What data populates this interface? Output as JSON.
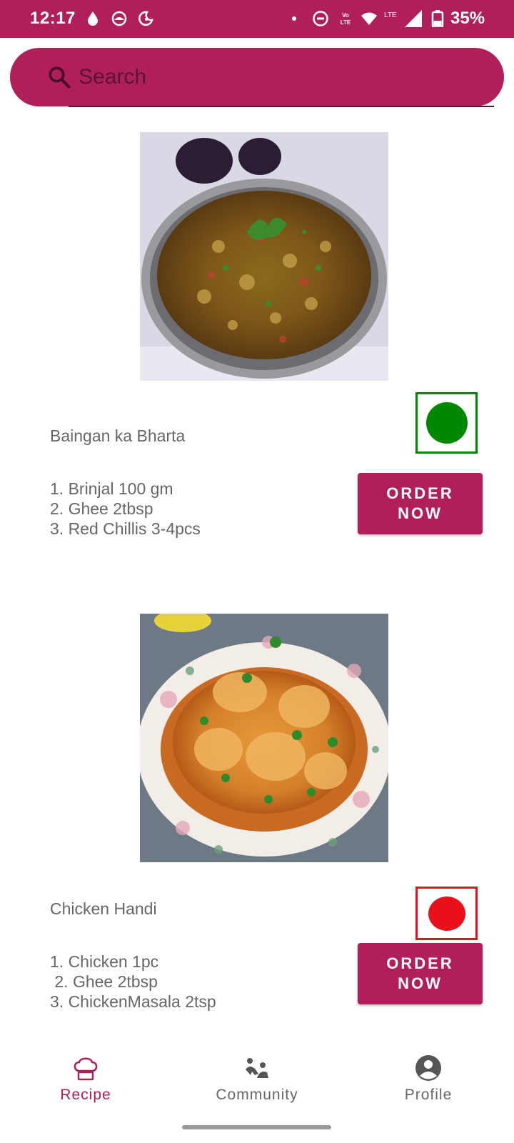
{
  "status_bar": {
    "time": "12:17",
    "battery": "35%",
    "icons": [
      "drop-icon",
      "sun-circle-icon",
      "moon-icon",
      "dot-icon",
      "do-not-disturb-icon",
      "volte-icon",
      "wifi-icon",
      "lte-signal-icon",
      "battery-icon"
    ]
  },
  "search": {
    "placeholder": "Search",
    "icon": "search-icon"
  },
  "recipes": [
    {
      "name": "Baingan ka Bharta",
      "ingredients": "1. Brinjal 100 gm\n2. Ghee 2tbsp\n3. Red Chillis 3-4pcs",
      "type": "veg",
      "indicator_color": "#008800",
      "order_label": "ORDER NOW"
    },
    {
      "name": "Chicken Handi",
      "ingredients": "1. Chicken 1pc\n 2. Ghee 2tbsp\n3. ChickenMasala 2tsp",
      "type": "non-veg",
      "indicator_color": "#e8101a",
      "order_label": "ORDER NOW"
    }
  ],
  "bottom_nav": {
    "items": [
      {
        "label": "Recipe",
        "icon": "chef-hat-icon",
        "active": true
      },
      {
        "label": "Community",
        "icon": "community-icon",
        "active": false
      },
      {
        "label": "Profile",
        "icon": "profile-icon",
        "active": false
      }
    ]
  },
  "colors": {
    "primary": "#b01f5a",
    "veg": "#008800",
    "non_veg": "#e8101a"
  }
}
